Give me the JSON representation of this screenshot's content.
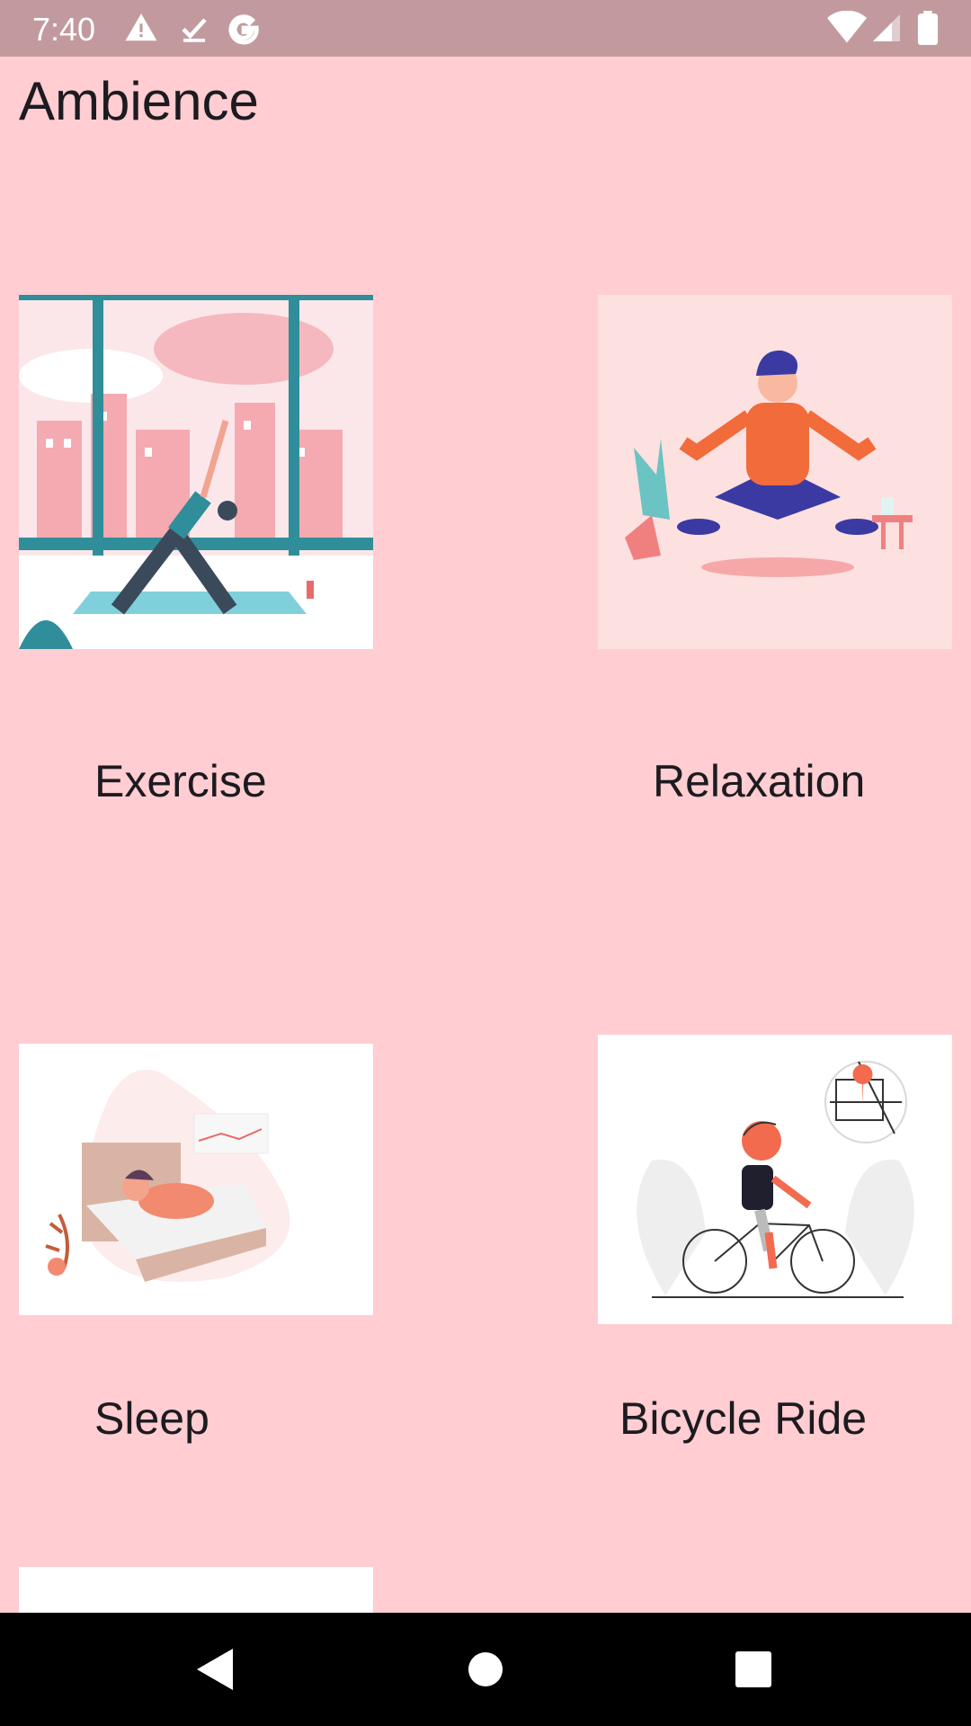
{
  "status_bar": {
    "time": "7:40",
    "icons": [
      "alert-icon",
      "download-done-icon",
      "google-icon",
      "wifi-icon",
      "signal-icon",
      "battery-icon"
    ]
  },
  "page": {
    "title": "Ambience"
  },
  "items": [
    {
      "label": "Exercise",
      "image": "yoga-illustration"
    },
    {
      "label": "Relaxation",
      "image": "meditation-illustration"
    },
    {
      "label": "Sleep",
      "image": "sleeping-illustration"
    },
    {
      "label": "Bicycle Ride",
      "image": "bicycle-illustration"
    }
  ],
  "nav_bar": {
    "buttons": [
      "back-icon",
      "home-icon",
      "recents-icon"
    ]
  },
  "colors": {
    "background": "#ffcdd2",
    "status_bar": "#c29a9e",
    "nav_bar": "#000000"
  }
}
